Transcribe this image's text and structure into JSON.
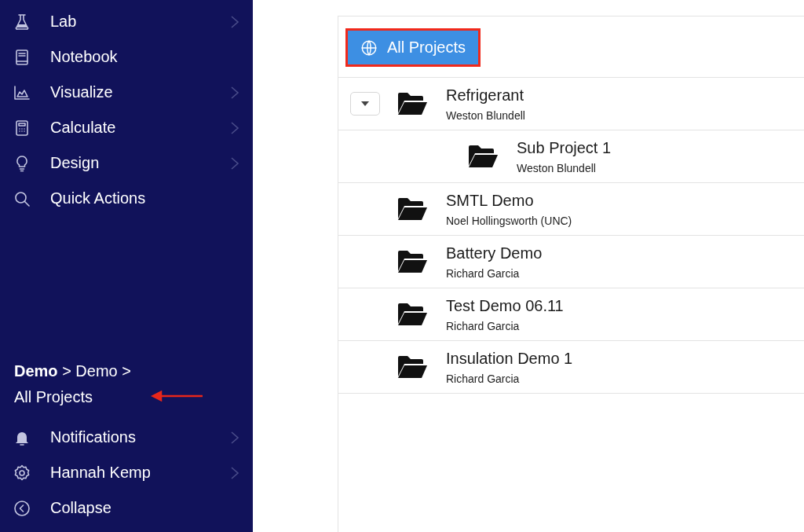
{
  "sidebar": {
    "items": [
      {
        "label": "Lab",
        "submenu": true
      },
      {
        "label": "Notebook",
        "submenu": false
      },
      {
        "label": "Visualize",
        "submenu": true
      },
      {
        "label": "Calculate",
        "submenu": true
      },
      {
        "label": "Design",
        "submenu": true
      },
      {
        "label": "Quick Actions",
        "submenu": false
      }
    ],
    "breadcrumb": "**Demo** > Demo > All Projects",
    "bottom_items": [
      {
        "label": "Notifications",
        "submenu": true
      },
      {
        "label": "Hannah Kemp",
        "submenu": true
      },
      {
        "label": "Collapse",
        "submenu": false
      }
    ]
  },
  "main": {
    "scope_button": "All Projects",
    "projects": [
      {
        "name": "Refrigerant",
        "owner": "Weston Blundell",
        "expanded": true,
        "children": [
          {
            "name": "Sub Project 1",
            "owner": "Weston Blundell"
          }
        ]
      },
      {
        "name": "SMTL Demo",
        "owner": "Noel Hollingsworth (UNC)"
      },
      {
        "name": "Battery Demo",
        "owner": "Richard Garcia"
      },
      {
        "name": "Test Demo 06.11",
        "owner": "Richard Garcia"
      },
      {
        "name": "Insulation Demo 1",
        "owner": "Richard Garcia"
      }
    ]
  }
}
